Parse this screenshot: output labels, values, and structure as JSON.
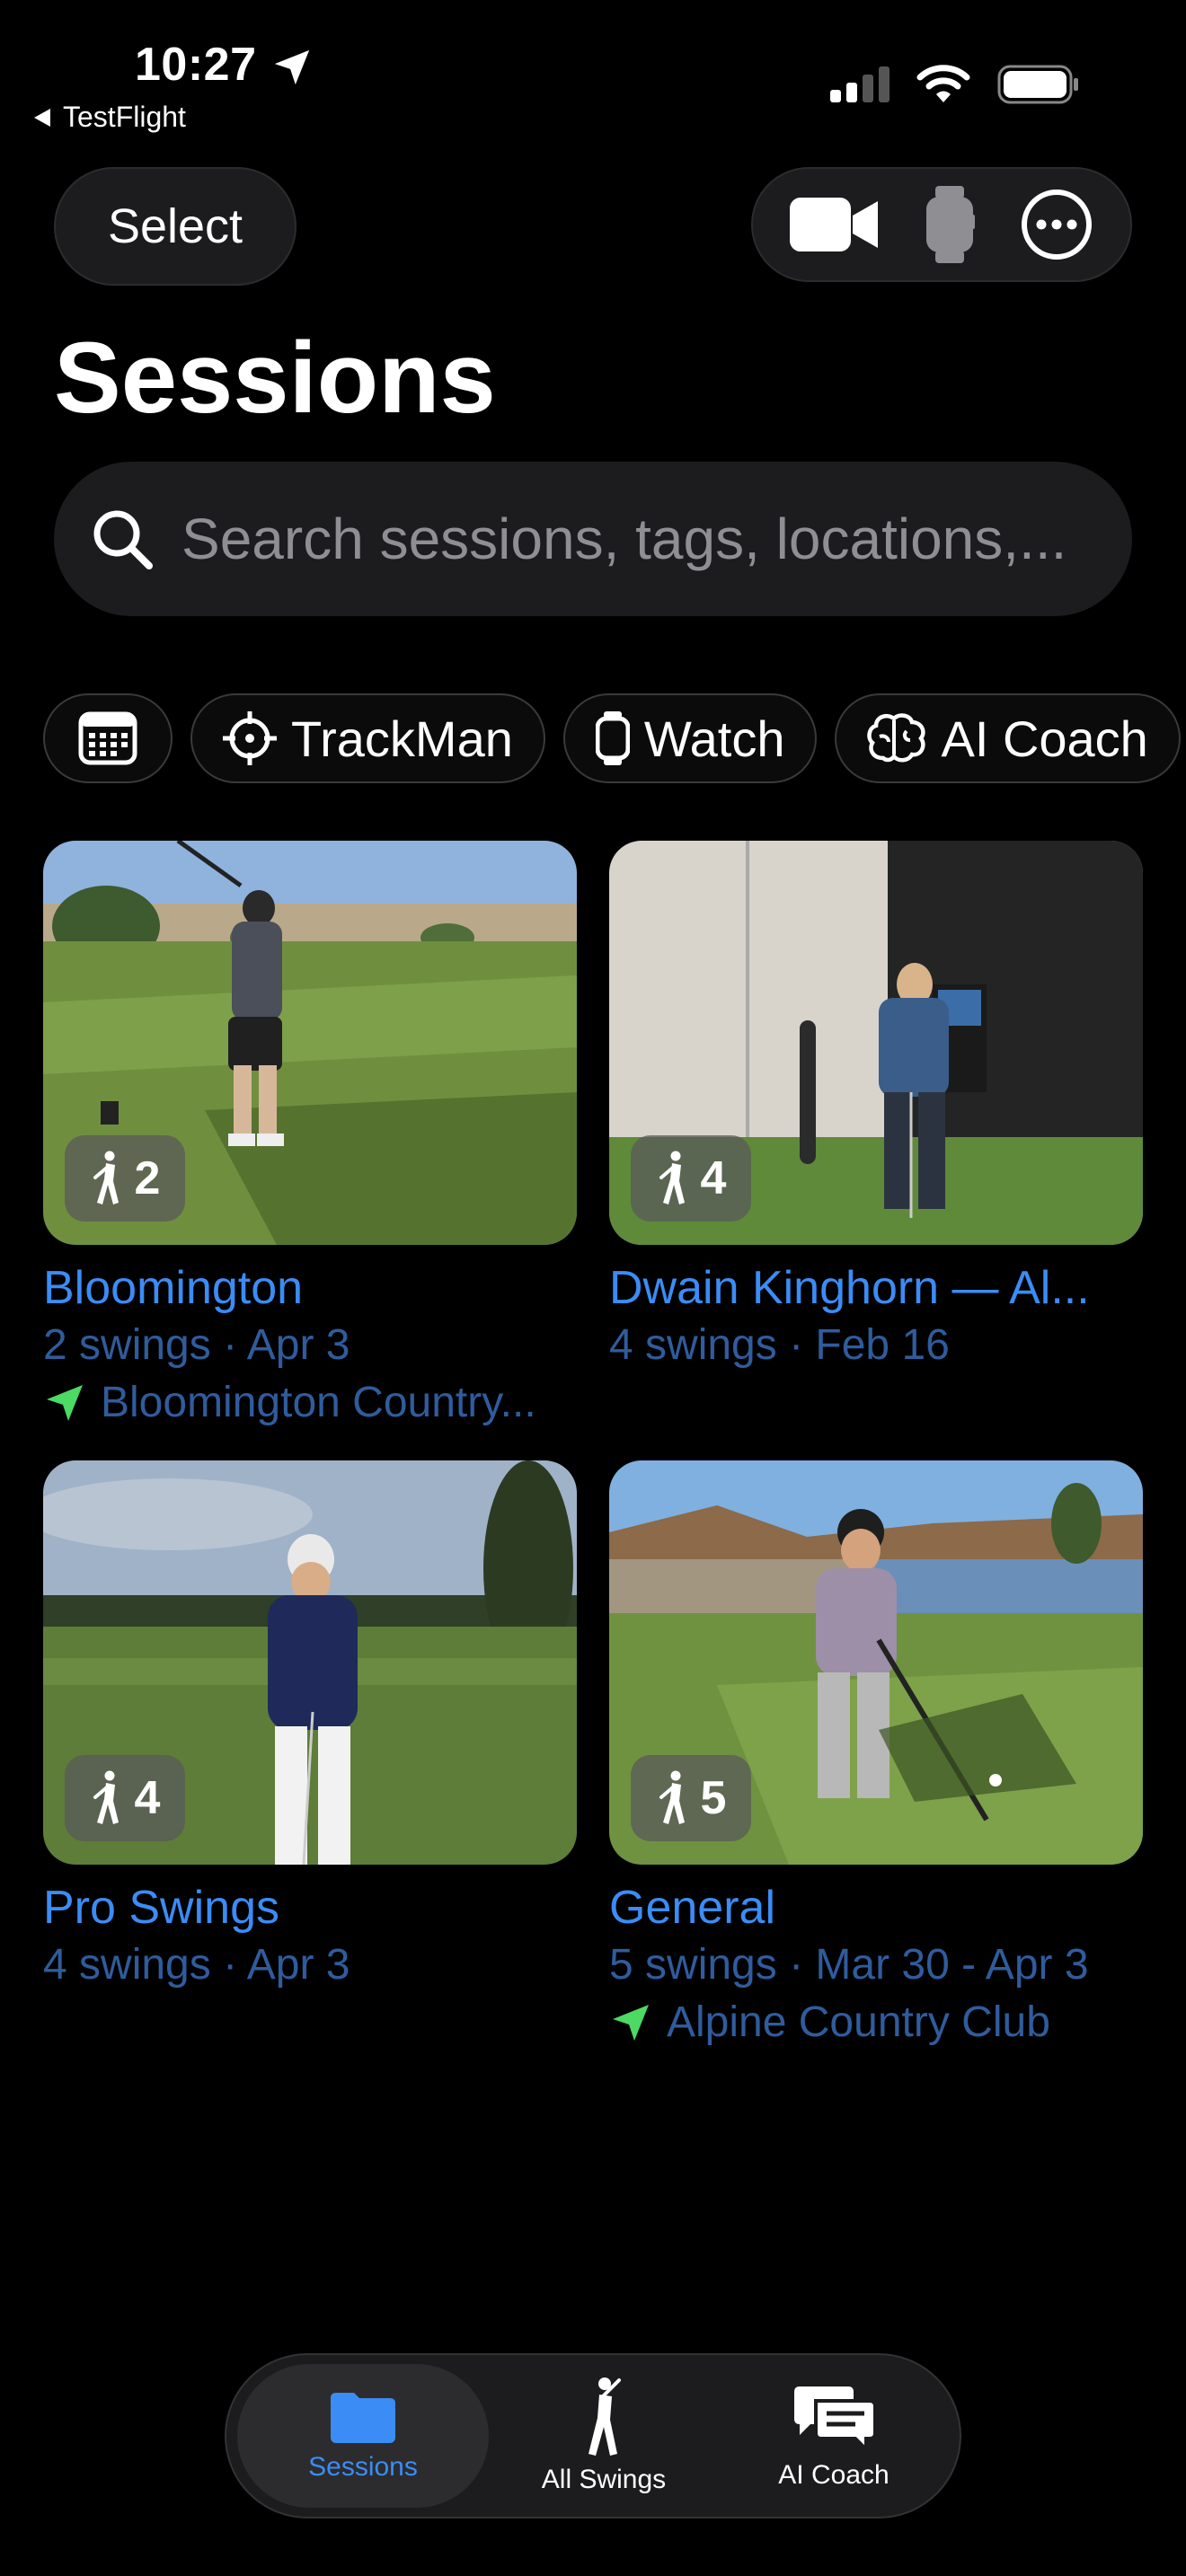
{
  "status_bar": {
    "time": "10:27",
    "back_app": "TestFlight"
  },
  "header": {
    "select_label": "Select",
    "title": "Sessions"
  },
  "search": {
    "placeholder": "Search sessions, tags, locations,..."
  },
  "filters": [
    {
      "label": "",
      "icon": "calendar-icon"
    },
    {
      "label": "TrackMan",
      "icon": "crosshair-icon"
    },
    {
      "label": "Watch",
      "icon": "watch-icon"
    },
    {
      "label": "AI Coach",
      "icon": "brain-icon"
    }
  ],
  "sessions": [
    {
      "title": "Bloomington",
      "count": "2",
      "details": "2 swings · Apr 3",
      "location": "Bloomington Country..."
    },
    {
      "title": "Dwain Kinghorn — Al...",
      "count": "4",
      "details": "4 swings · Feb 16",
      "location": ""
    },
    {
      "title": "Pro Swings",
      "count": "4",
      "details": "4 swings · Apr 3",
      "location": ""
    },
    {
      "title": "General",
      "count": "5",
      "details": "5 swings · Mar 30 - Apr 3",
      "location": "Alpine Country Club"
    }
  ],
  "tabbar": {
    "tabs": [
      {
        "label": "Sessions",
        "active": true
      },
      {
        "label": "All Swings",
        "active": false
      },
      {
        "label": "AI Coach",
        "active": false
      }
    ]
  },
  "colors": {
    "accent": "#3b8cf5",
    "location_arrow": "#4cd964",
    "background": "#000000"
  }
}
